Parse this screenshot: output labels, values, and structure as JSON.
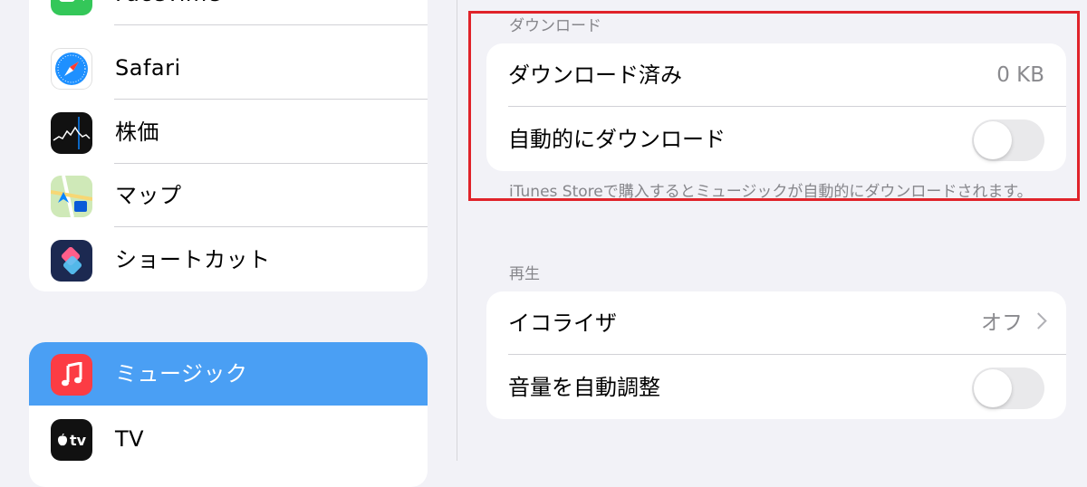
{
  "sidebar": {
    "group1": [
      {
        "label": "FaceTime",
        "icon": "facetime-icon"
      },
      {
        "label": "Safari",
        "icon": "safari-icon"
      },
      {
        "label": "株価",
        "icon": "stocks-icon"
      },
      {
        "label": "マップ",
        "icon": "maps-icon"
      },
      {
        "label": "ショートカット",
        "icon": "shortcuts-icon"
      }
    ],
    "group2": [
      {
        "label": "ミュージック",
        "icon": "music-icon",
        "selected": true
      },
      {
        "label": "TV",
        "icon": "tv-icon"
      }
    ],
    "tv_icon_text": "tv"
  },
  "download_section": {
    "header": "ダウンロード",
    "downloaded_label": "ダウンロード済み",
    "downloaded_value": "0 KB",
    "auto_download_label": "自動的にダウンロード",
    "auto_download_on": false,
    "footnote": "iTunes Storeで購入するとミュージックが自動的にダウンロードされます。"
  },
  "playback_section": {
    "header": "再生",
    "eq_label": "イコライザ",
    "eq_value": "オフ",
    "sound_check_label": "音量を自動調整",
    "sound_check_on": false
  },
  "colors": {
    "selected_row": "#4a9ff4",
    "highlight_box": "#e0232a",
    "background": "#f2f2f7"
  }
}
